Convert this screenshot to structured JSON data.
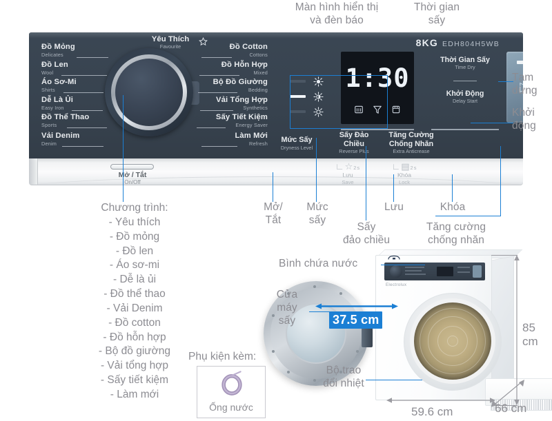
{
  "product": {
    "capacity": "8KG",
    "model": "EDH804H5WB"
  },
  "display": {
    "time": "1:30",
    "status_icons": [
      "heat-icon",
      "filter-icon",
      "water-tank-icon"
    ]
  },
  "favourite": {
    "vn": "Yêu Thích",
    "en": "Favourite",
    "icon": "star-icon"
  },
  "programs_left": [
    {
      "vn": "Đồ Mỏng",
      "en": "Delicates"
    },
    {
      "vn": "Đồ Len",
      "en": "Wool"
    },
    {
      "vn": "Áo Sơ-Mi",
      "en": "Shirts"
    },
    {
      "vn": "Dễ Là Ủi",
      "en": "Easy Iron"
    },
    {
      "vn": "Đồ Thể Thao",
      "en": "Sports"
    },
    {
      "vn": "Vải Denim",
      "en": "Denim"
    }
  ],
  "programs_right": [
    {
      "vn": "Đồ Cotton",
      "en": "Cottons"
    },
    {
      "vn": "Đồ Hỗn Hợp",
      "en": "Mixed"
    },
    {
      "vn": "Bộ Đồ Giường",
      "en": "Bedding"
    },
    {
      "vn": "Vải Tổng Hợp",
      "en": "Synthetics"
    },
    {
      "vn": "Sấy Tiết Kiệm",
      "en": "Energy Saver"
    },
    {
      "vn": "Làm Mới",
      "en": "Refresh"
    }
  ],
  "panel_controls": {
    "dryness": {
      "vn": "Mức Sấy",
      "en": "Dryness Level"
    },
    "reverse": {
      "vn": "Sấy Đảo\nChiều",
      "en": "Reverse Plus"
    },
    "anticrease": {
      "vn": "Tăng Cường\nChống Nhăn",
      "en": "Extra Anticrease"
    },
    "time_dry": {
      "vn": "Thời Gian Sấy",
      "en": "Time Dry"
    },
    "delay_start": {
      "vn": "Khởi Động",
      "en": "Delay Start"
    },
    "power": {
      "vn": "Mở / Tắt",
      "en": "On/Off"
    },
    "save": {
      "vn": "Lưu",
      "en": "Save",
      "hold": "2s",
      "icon": "star-icon"
    },
    "lock": {
      "vn": "Khóa",
      "en": "Lock",
      "hold": "2s",
      "icon": "lock-icon"
    },
    "start_pause": {
      "icon": "play-pause-icon"
    }
  },
  "annotations": {
    "display_label": "Màn hình hiển thị\nvà đèn báo",
    "drying_time": "Thời gian\nsấy",
    "pause": "Tạm\ndừng",
    "start": "Khởi\nđộng",
    "power": "Mở/\nTắt",
    "dryness": "Mức\nsấy",
    "save": "Lưu",
    "lock": "Khóa",
    "reverse": "Sấy\nđảo chiều",
    "anticrease": "Tăng cường\nchống nhăn",
    "water_tank": "Bình chứa nước",
    "door": "Cửa\nmáy\nsấy",
    "heat_exchanger": "Bộ trao\nđổi nhiệt"
  },
  "program_list": {
    "heading": "Chương trình:",
    "items": [
      "- Yêu thích",
      "- Đồ mỏng",
      "- Đồ len",
      "- Áo sơ-mi",
      "- Dễ là ủi",
      "- Đồ thể thao",
      "- Vải Denim",
      "- Đồ cotton",
      "- Đồ hỗn hợp",
      "- Bộ đồ giường",
      "- Vải tổng hợp",
      "- Sấy tiết kiệm",
      "- Làm mới"
    ]
  },
  "accessory": {
    "title": "Phụ kiện kèm:",
    "item": "Ống nước",
    "icon": "water-hose-icon"
  },
  "dimensions": {
    "drum_depth": "37.5 cm",
    "height": "85 cm",
    "width": "59.6 cm",
    "depth": "66 cm"
  },
  "colors": {
    "accent": "#1b7fd4",
    "panel_dark": "#38434f",
    "annotation_text": "#8c8c92"
  }
}
